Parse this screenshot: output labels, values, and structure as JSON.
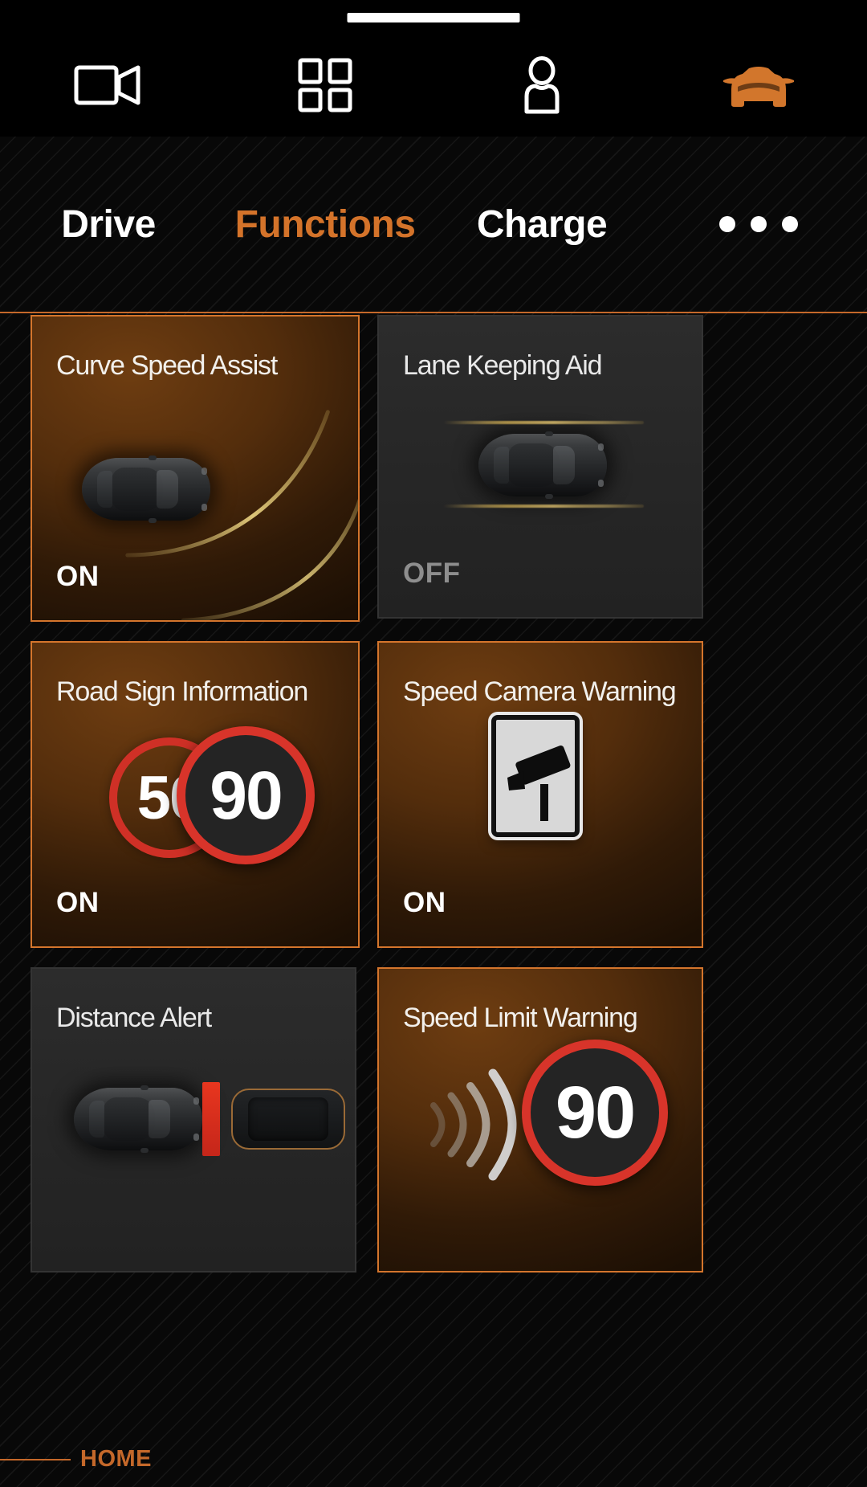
{
  "topbar": {
    "items": [
      {
        "icon": "video-camera-icon",
        "name": "camera"
      },
      {
        "icon": "grid-apps-icon",
        "name": "apps"
      },
      {
        "icon": "user-profile-icon",
        "name": "profile"
      },
      {
        "icon": "car-front-icon",
        "name": "vehicle"
      }
    ]
  },
  "tabs": [
    {
      "label": "Drive",
      "active": false
    },
    {
      "label": "Functions",
      "active": true
    },
    {
      "label": "Charge",
      "active": false
    }
  ],
  "overflow": {
    "name": "more-options",
    "dots": 3
  },
  "cards": [
    {
      "title": "Curve Speed Assist",
      "state": "ON",
      "active": true,
      "art": "car-with-curve-arcs"
    },
    {
      "title": "Lane Keeping Aid",
      "state": "OFF",
      "active": false,
      "art": "car-between-lane-lines"
    },
    {
      "title": "Road Sign Information",
      "state": "ON",
      "active": true,
      "art": "two-speed-limit-signs",
      "sign_back": "50",
      "sign_front": "90"
    },
    {
      "title": "Speed Camera Warning",
      "state": "ON",
      "active": true,
      "art": "speed-camera-sign"
    },
    {
      "title": "Distance Alert",
      "state": "",
      "active": false,
      "art": "two-cars-with-distance-bar"
    },
    {
      "title": "Speed Limit Warning",
      "state": "",
      "active": true,
      "art": "waves-with-speed-sign",
      "sign_front": "90"
    }
  ],
  "bottom": {
    "home_label": "HOME"
  },
  "colors": {
    "accent": "#d4752c",
    "accent_line": "#c4682a",
    "active_card_border": "#d4752c",
    "inactive_card_bg": "#2a2a2a",
    "sign_red": "#d8342a",
    "lane_gold": "#decb5c",
    "distance_red": "#e8361f",
    "text_primary": "#ffffff",
    "text_off": "#8e8e8e"
  }
}
